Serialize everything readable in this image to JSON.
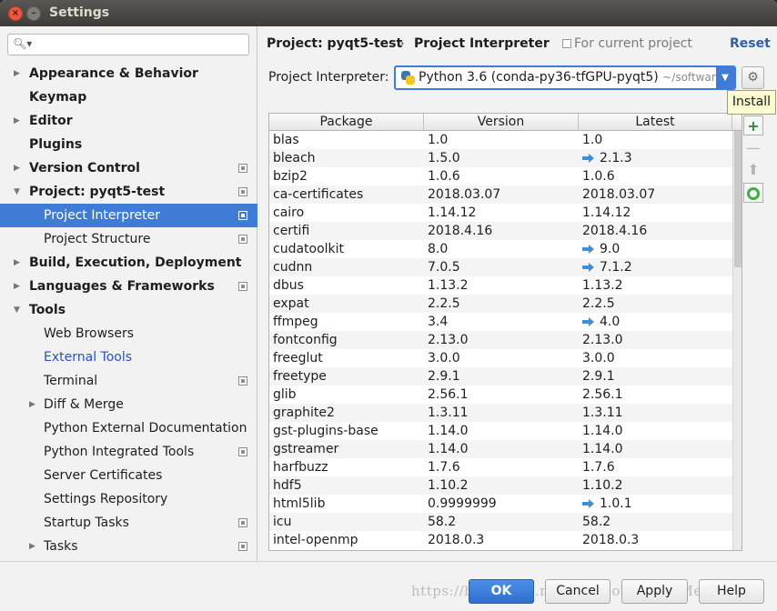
{
  "window": {
    "title": "Settings"
  },
  "search": {
    "placeholder": "",
    "value": ""
  },
  "sidebar": {
    "items": [
      {
        "label": "Appearance & Behavior",
        "bold": true,
        "arrow": "right",
        "indent": 0,
        "icon": false,
        "selected": false,
        "link": false
      },
      {
        "label": "Keymap",
        "bold": true,
        "arrow": "",
        "indent": 0,
        "icon": false,
        "selected": false,
        "link": false
      },
      {
        "label": "Editor",
        "bold": true,
        "arrow": "right",
        "indent": 0,
        "icon": false,
        "selected": false,
        "link": false
      },
      {
        "label": "Plugins",
        "bold": true,
        "arrow": "",
        "indent": 0,
        "icon": false,
        "selected": false,
        "link": false
      },
      {
        "label": "Version Control",
        "bold": true,
        "arrow": "right",
        "indent": 0,
        "icon": true,
        "selected": false,
        "link": false
      },
      {
        "label": "Project: pyqt5-test",
        "bold": true,
        "arrow": "down",
        "indent": 0,
        "icon": true,
        "selected": false,
        "link": false
      },
      {
        "label": "Project Interpreter",
        "bold": false,
        "arrow": "",
        "indent": 1,
        "icon": true,
        "selected": true,
        "link": false
      },
      {
        "label": "Project Structure",
        "bold": false,
        "arrow": "",
        "indent": 1,
        "icon": true,
        "selected": false,
        "link": false
      },
      {
        "label": "Build, Execution, Deployment",
        "bold": true,
        "arrow": "right",
        "indent": 0,
        "icon": false,
        "selected": false,
        "link": false
      },
      {
        "label": "Languages & Frameworks",
        "bold": true,
        "arrow": "right",
        "indent": 0,
        "icon": true,
        "selected": false,
        "link": false
      },
      {
        "label": "Tools",
        "bold": true,
        "arrow": "down",
        "indent": 0,
        "icon": false,
        "selected": false,
        "link": false
      },
      {
        "label": "Web Browsers",
        "bold": false,
        "arrow": "",
        "indent": 1,
        "icon": false,
        "selected": false,
        "link": false
      },
      {
        "label": "External Tools",
        "bold": false,
        "arrow": "",
        "indent": 1,
        "icon": false,
        "selected": false,
        "link": true
      },
      {
        "label": "Terminal",
        "bold": false,
        "arrow": "",
        "indent": 1,
        "icon": true,
        "selected": false,
        "link": false
      },
      {
        "label": "Diff & Merge",
        "bold": false,
        "arrow": "right",
        "indent": 1,
        "icon": false,
        "selected": false,
        "link": false
      },
      {
        "label": "Python External Documentation",
        "bold": false,
        "arrow": "",
        "indent": 1,
        "icon": false,
        "selected": false,
        "link": false
      },
      {
        "label": "Python Integrated Tools",
        "bold": false,
        "arrow": "",
        "indent": 1,
        "icon": true,
        "selected": false,
        "link": false
      },
      {
        "label": "Server Certificates",
        "bold": false,
        "arrow": "",
        "indent": 1,
        "icon": false,
        "selected": false,
        "link": false
      },
      {
        "label": "Settings Repository",
        "bold": false,
        "arrow": "",
        "indent": 1,
        "icon": false,
        "selected": false,
        "link": false
      },
      {
        "label": "Startup Tasks",
        "bold": false,
        "arrow": "",
        "indent": 1,
        "icon": true,
        "selected": false,
        "link": false
      },
      {
        "label": "Tasks",
        "bold": false,
        "arrow": "right",
        "indent": 1,
        "icon": true,
        "selected": false,
        "link": false
      }
    ]
  },
  "header": {
    "breadcrumb_project": "Project: pyqt5-test",
    "breadcrumb_separator": "›",
    "breadcrumb_page": "Project Interpreter",
    "scope_label": "For current project",
    "reset_label": "Reset"
  },
  "interpreter": {
    "label": "Project Interpreter:",
    "value": "Python 3.6 (conda-py36-tfGPU-pyqt5)",
    "path": "~/software-"
  },
  "tooltip": {
    "text": "Install"
  },
  "table": {
    "columns": [
      "Package",
      "Version",
      "Latest"
    ],
    "rows": [
      {
        "package": "blas",
        "version": "1.0",
        "latest": "1.0",
        "upgrade": false
      },
      {
        "package": "bleach",
        "version": "1.5.0",
        "latest": "2.1.3",
        "upgrade": true
      },
      {
        "package": "bzip2",
        "version": "1.0.6",
        "latest": "1.0.6",
        "upgrade": false
      },
      {
        "package": "ca-certificates",
        "version": "2018.03.07",
        "latest": "2018.03.07",
        "upgrade": false
      },
      {
        "package": "cairo",
        "version": "1.14.12",
        "latest": "1.14.12",
        "upgrade": false
      },
      {
        "package": "certifi",
        "version": "2018.4.16",
        "latest": "2018.4.16",
        "upgrade": false
      },
      {
        "package": "cudatoolkit",
        "version": "8.0",
        "latest": "9.0",
        "upgrade": true
      },
      {
        "package": "cudnn",
        "version": "7.0.5",
        "latest": "7.1.2",
        "upgrade": true
      },
      {
        "package": "dbus",
        "version": "1.13.2",
        "latest": "1.13.2",
        "upgrade": false
      },
      {
        "package": "expat",
        "version": "2.2.5",
        "latest": "2.2.5",
        "upgrade": false
      },
      {
        "package": "ffmpeg",
        "version": "3.4",
        "latest": "4.0",
        "upgrade": true
      },
      {
        "package": "fontconfig",
        "version": "2.13.0",
        "latest": "2.13.0",
        "upgrade": false
      },
      {
        "package": "freeglut",
        "version": "3.0.0",
        "latest": "3.0.0",
        "upgrade": false
      },
      {
        "package": "freetype",
        "version": "2.9.1",
        "latest": "2.9.1",
        "upgrade": false
      },
      {
        "package": "glib",
        "version": "2.56.1",
        "latest": "2.56.1",
        "upgrade": false
      },
      {
        "package": "graphite2",
        "version": "1.3.11",
        "latest": "1.3.11",
        "upgrade": false
      },
      {
        "package": "gst-plugins-base",
        "version": "1.14.0",
        "latest": "1.14.0",
        "upgrade": false
      },
      {
        "package": "gstreamer",
        "version": "1.14.0",
        "latest": "1.14.0",
        "upgrade": false
      },
      {
        "package": "harfbuzz",
        "version": "1.7.6",
        "latest": "1.7.6",
        "upgrade": false
      },
      {
        "package": "hdf5",
        "version": "1.10.2",
        "latest": "1.10.2",
        "upgrade": false
      },
      {
        "package": "html5lib",
        "version": "0.9999999",
        "latest": "1.0.1",
        "upgrade": true
      },
      {
        "package": "icu",
        "version": "58.2",
        "latest": "58.2",
        "upgrade": false
      },
      {
        "package": "intel-openmp",
        "version": "2018.0.3",
        "latest": "2018.0.3",
        "upgrade": false
      }
    ]
  },
  "buttons": {
    "ok": "OK",
    "cancel": "Cancel",
    "apply": "Apply",
    "help": "Help"
  },
  "watermark": "https://blog.csdn.net/StubbornForgeMe",
  "colors": {
    "selection": "#3e7cd6",
    "link": "#2750c7",
    "upgrade_arrow": "#3d8fd6",
    "add_icon": "#2e8b3a"
  }
}
